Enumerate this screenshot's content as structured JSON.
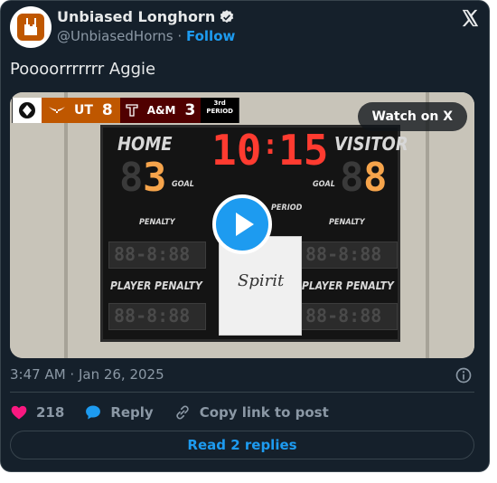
{
  "author": {
    "display_name": "Unbiased Longhorn",
    "handle": "@UnbiasedHorns",
    "separator": "·",
    "follow_label": "Follow",
    "verified": true
  },
  "post": {
    "text": "Poooorrrrrrr Aggie",
    "timestamp": "3:47 AM · Jan 26, 2025"
  },
  "media": {
    "watch_label": "Watch on X",
    "score_overlay": {
      "team1": "UT",
      "score1": "8",
      "team2": "A&M",
      "score2": "3",
      "period_line1": "3rd",
      "period_line2": "PERIOD"
    },
    "scoreboard": {
      "home_label": "HOME",
      "visitor_label": "VISITOR",
      "clock_min": "10",
      "clock_sec": "15",
      "home_score": "3",
      "visitor_score": "8",
      "goal_label": "GOAL",
      "penalty_label": "PENALTY",
      "period_label": "PERIOD",
      "player_label": "PLAYER",
      "penalty_label2": "PENALTY",
      "spirit_text": "Spirit"
    }
  },
  "actions": {
    "like_count": "218",
    "reply_label": "Reply",
    "copy_label": "Copy link to post"
  },
  "footer": {
    "read_replies_label": "Read 2 replies"
  },
  "colors": {
    "background": "#15202b",
    "accent": "#1d9bf0",
    "like": "#f91880",
    "burnt_orange": "#bf5700",
    "maroon": "#500000"
  }
}
